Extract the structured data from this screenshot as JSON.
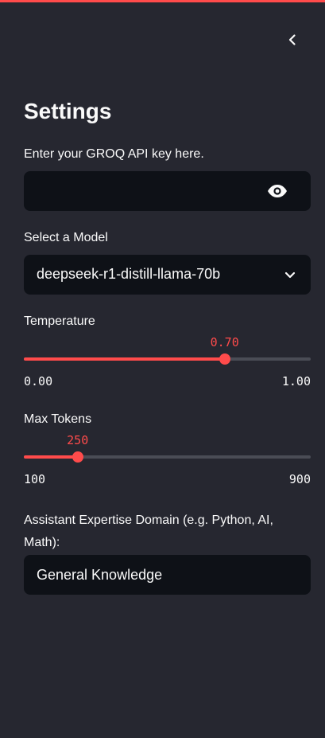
{
  "settings": {
    "title": "Settings",
    "api_key": {
      "label": "Enter your GROQ API key here.",
      "value": "",
      "icon": "eye-icon"
    },
    "model": {
      "label": "Select a Model",
      "selected": "deepseek-r1-distill-llama-70b",
      "icon": "chevron-down-icon"
    },
    "temperature": {
      "label": "Temperature",
      "value": 0.7,
      "value_text": "0.70",
      "min_text": "0.00",
      "max_text": "1.00",
      "min": 0,
      "max": 1
    },
    "max_tokens": {
      "label": "Max Tokens",
      "value": 250,
      "value_text": "250",
      "min_text": "100",
      "max_text": "900",
      "min": 100,
      "max": 900
    },
    "domain": {
      "label": "Assistant Expertise Domain (e.g. Python, AI, Math):",
      "value": "General Knowledge"
    }
  },
  "colors": {
    "accent": "#ff4b4b",
    "sidebar_bg": "#262730",
    "input_bg": "#0e1117",
    "text": "#fafafa"
  }
}
